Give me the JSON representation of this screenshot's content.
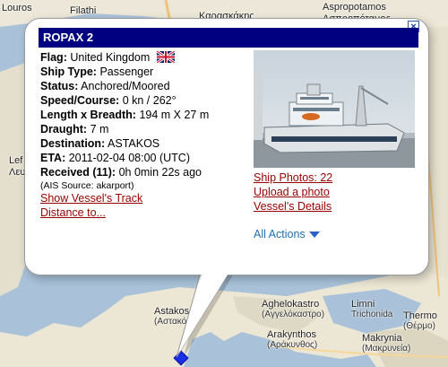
{
  "map": {
    "places": [
      {
        "name": "Louros",
        "sub": ""
      },
      {
        "name": "Filathi",
        "sub": ""
      },
      {
        "name": "Καρασκάκης",
        "sub": ""
      },
      {
        "name": "Aspropotamos",
        "sub": ""
      },
      {
        "name": "Ασπροπόταμος",
        "sub": ""
      },
      {
        "name": "Lef",
        "sub": ""
      },
      {
        "name": "Λευ",
        "sub": ""
      },
      {
        "name": "Astakos",
        "sub": "(Αστακός)"
      },
      {
        "name": "Aghelokastro",
        "sub": "(Αγγελόκαστρο)"
      },
      {
        "name": "Limni",
        "sub": "Trichonida"
      },
      {
        "name": "Thermo",
        "sub": "(Θέρμο)"
      },
      {
        "name": "Arakynthos",
        "sub": "(Αράκυνθος)"
      },
      {
        "name": "Makrynia",
        "sub": "(Μακρυνεία)"
      }
    ]
  },
  "popup": {
    "close_glyph": "×",
    "ship_name": "ROPAX 2",
    "flag_label": "Flag:",
    "flag_value": "United Kingdom",
    "ship_type_label": "Ship Type:",
    "ship_type_value": "Passenger",
    "status_label": "Status:",
    "status_value": "Anchored/Moored",
    "speed_label": "Speed/Course:",
    "speed_value": "0 kn / 262°",
    "length_label": "Length x Breadth:",
    "length_value": "194 m X 27 m",
    "draught_label": "Draught:",
    "draught_value": "7 m",
    "destination_label": "Destination:",
    "destination_value": "ASTAKOS",
    "eta_label": "ETA:",
    "eta_value": "2011-02-04 08:00 (UTC)",
    "received_label": "Received (11):",
    "received_value": "0h 0min 22s ago",
    "ais_source": "(AIS Source: akarport)",
    "show_track": "Show Vessel's Track",
    "distance_to": "Distance to...",
    "ship_photos": "Ship Photos: 22",
    "upload_photo": "Upload a photo",
    "vessel_details": "Vessel's Details",
    "all_actions": "All Actions"
  },
  "colors": {
    "title_bar": "#000080",
    "link": "#990000",
    "all_actions": "#1f6fb0",
    "marker": "#1a2ee8",
    "water": "#a9c2d9"
  },
  "icons": {
    "flag": "uk-flag-icon",
    "close": "close-icon",
    "dropdown": "triangle-down-icon",
    "marker": "vessel-marker-icon"
  }
}
